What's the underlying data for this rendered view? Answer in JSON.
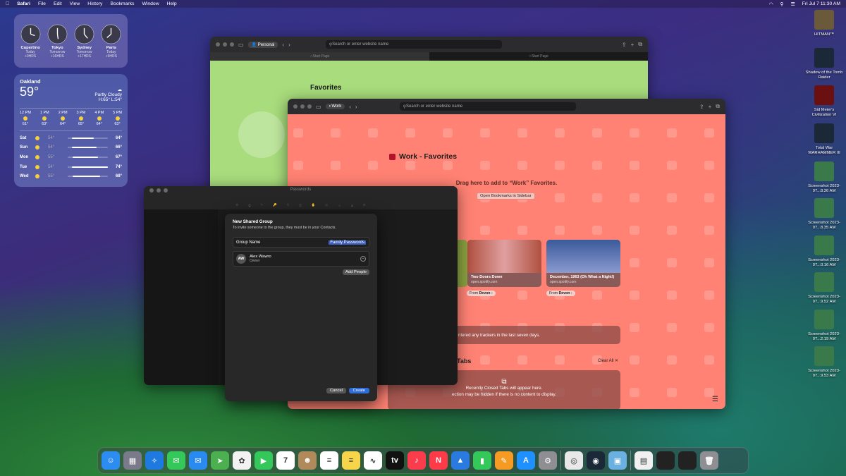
{
  "menubar": {
    "app": "Safari",
    "menus": [
      "File",
      "Edit",
      "View",
      "History",
      "Bookmarks",
      "Window",
      "Help"
    ],
    "datetime": "Fri Jul 7  11:30 AM"
  },
  "clocks": [
    {
      "city": "Cupertino",
      "day": "Today",
      "offset": "+0HRS"
    },
    {
      "city": "Tokyo",
      "day": "Tomorrow",
      "offset": "+16HRS"
    },
    {
      "city": "Sydney",
      "day": "Tomorrow",
      "offset": "+17HRS"
    },
    {
      "city": "Paris",
      "day": "Today",
      "offset": "+9HRS"
    }
  ],
  "weather": {
    "city": "Oakland",
    "temp": "59°",
    "condition": "Partly Cloudy",
    "hilo": "H:65° L:54°",
    "hourly": [
      {
        "time": "12 PM",
        "temp": "61°"
      },
      {
        "time": "1 PM",
        "temp": "63°"
      },
      {
        "time": "2 PM",
        "temp": "64°"
      },
      {
        "time": "3 PM",
        "temp": "65°"
      },
      {
        "time": "4 PM",
        "temp": "64°"
      },
      {
        "time": "5 PM",
        "temp": "63°"
      }
    ],
    "daily": [
      {
        "day": "Sat",
        "lo": "54°",
        "hi": "64°"
      },
      {
        "day": "Sun",
        "lo": "54°",
        "hi": "66°"
      },
      {
        "day": "Mon",
        "lo": "55°",
        "hi": "67°"
      },
      {
        "day": "Tue",
        "lo": "54°",
        "hi": "74°"
      },
      {
        "day": "Wed",
        "lo": "55°",
        "hi": "68°"
      }
    ]
  },
  "safari_personal": {
    "profile": "Personal",
    "search_placeholder": "Search or enter website name",
    "tabs": [
      "Start Page",
      "Start Page"
    ],
    "favorites_title": "Favorites"
  },
  "safari_work": {
    "profile": "Work",
    "search_placeholder": "Search or enter website name",
    "title": "Work - Favorites",
    "drag_text": "Drag here to add to “Work” Favorites.",
    "open_bookmarks": "Open Bookmarks in Sidebar",
    "cards": [
      {
        "title": "Two Doors Down",
        "url": "open.spotify.com",
        "from": "From",
        "from_name": "Devon"
      },
      {
        "title": "December, 1963 (Oh What a Night!)",
        "url": "open.spotify.com",
        "from": "From",
        "from_name": "Devon"
      }
    ],
    "extra_from": "From",
    "extra_from_name": "Devon",
    "privacy_text": "ntered any trackers in the last seven days.",
    "recent_title": "Tabs",
    "clear_all": "Clear All",
    "recent_line1": "Recently Closed Tabs will appear here.",
    "recent_line2": "ection may be hidden if there is no content to display."
  },
  "passwords": {
    "title": "Passwords"
  },
  "sheet": {
    "title": "New Shared Group",
    "subtitle": "To invite someone to the group, they must be in your Contacts.",
    "group_label": "Group Name",
    "group_value": "Family Passwords",
    "member_initials": "AW",
    "member_name": "Alex Wawro",
    "member_role": "Owner",
    "add_people": "Add People",
    "cancel": "Cancel",
    "create": "Create"
  },
  "desktop": [
    {
      "label": "HITMAN™",
      "color": "#6b5a3a"
    },
    {
      "label": "Shadow of the Tomb Raider",
      "color": "#1b2838"
    },
    {
      "label": "Sid Meier's Civilization VI",
      "color": "#6b1010"
    },
    {
      "label": "Total War WARHAMMER III",
      "color": "#1b2838"
    },
    {
      "label": "Screenshot 2023-07...8.26 AM",
      "color": "#3a7a4a"
    },
    {
      "label": "Screenshot 2023-07...8.35 AM",
      "color": "#3a7a4a"
    },
    {
      "label": "Screenshot 2023-07...0.16 AM",
      "color": "#3a7a4a"
    },
    {
      "label": "Screenshot 2023-07...9.52 AM",
      "color": "#3a7a4a"
    },
    {
      "label": "Screenshot 2023-07...2.19 AM",
      "color": "#3a7a4a"
    },
    {
      "label": "Screenshot 2023-07...9.53 AM",
      "color": "#3a7a4a"
    }
  ],
  "dock": [
    {
      "name": "finder",
      "color": "#2d8cf0",
      "glyph": "☺"
    },
    {
      "name": "launchpad",
      "color": "#7a7a8a",
      "glyph": "▦"
    },
    {
      "name": "safari",
      "color": "#1f7ae0",
      "glyph": "✧"
    },
    {
      "name": "messages",
      "color": "#34c759",
      "glyph": "✉"
    },
    {
      "name": "mail",
      "color": "#2a8af0",
      "glyph": "✉"
    },
    {
      "name": "maps",
      "color": "#4caf50",
      "glyph": "➤"
    },
    {
      "name": "photos",
      "color": "#f2f2f2",
      "glyph": "✿"
    },
    {
      "name": "facetime",
      "color": "#34c759",
      "glyph": "▶"
    },
    {
      "name": "calendar",
      "color": "#ffffff",
      "glyph": "7"
    },
    {
      "name": "contacts",
      "color": "#b08a5a",
      "glyph": "☻"
    },
    {
      "name": "reminders",
      "color": "#ffffff",
      "glyph": "≡"
    },
    {
      "name": "notes",
      "color": "#f7d54a",
      "glyph": "≡"
    },
    {
      "name": "freeform",
      "color": "#ffffff",
      "glyph": "∿"
    },
    {
      "name": "apple-tv",
      "color": "#111111",
      "glyph": "tv"
    },
    {
      "name": "music",
      "color": "#fa3c4c",
      "glyph": "♪"
    },
    {
      "name": "news",
      "color": "#ff3b4a",
      "glyph": "N"
    },
    {
      "name": "keynote",
      "color": "#2a7ae0",
      "glyph": "▲"
    },
    {
      "name": "numbers",
      "color": "#34c759",
      "glyph": "▮"
    },
    {
      "name": "pages",
      "color": "#f59a23",
      "glyph": "✎"
    },
    {
      "name": "app-store",
      "color": "#1e90ff",
      "glyph": "A"
    },
    {
      "name": "system-settings",
      "color": "#8e8e93",
      "glyph": "⚙"
    },
    {
      "name": "chrome",
      "color": "#e8e8e8",
      "glyph": "◎"
    },
    {
      "name": "steam",
      "color": "#1b2838",
      "glyph": "◉"
    },
    {
      "name": "preview",
      "color": "#6ab0e0",
      "glyph": "▣"
    },
    {
      "name": "document",
      "color": "#f0f0f0",
      "glyph": "▤"
    },
    {
      "name": "window-1",
      "color": "#222222",
      "glyph": ""
    },
    {
      "name": "window-2",
      "color": "#222222",
      "glyph": ""
    },
    {
      "name": "trash",
      "color": "#8e8e93",
      "glyph": "🗑"
    }
  ]
}
